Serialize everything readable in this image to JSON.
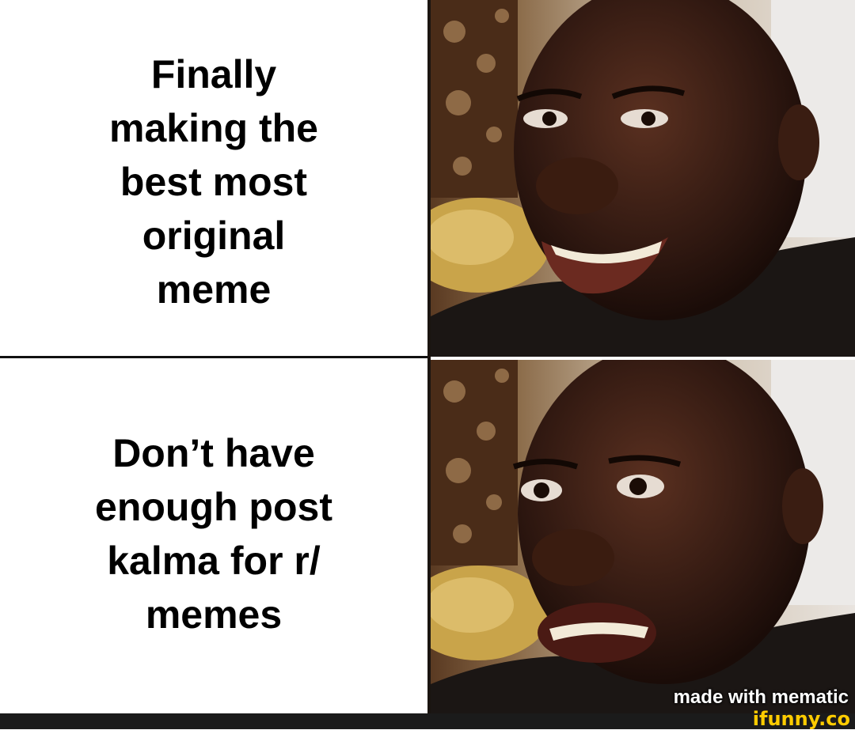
{
  "meme": {
    "top_caption": "Finally\nmaking the\nbest most\noriginal\nmeme",
    "bottom_caption": "Don’t have\nenough post\nkalma for r/\nmemes",
    "top_image": "happy-man-smiling",
    "bottom_image": "man-disappointed",
    "watermark": "made with mematic",
    "site_logo": "ifunny.co"
  },
  "colors": {
    "text": "#000000",
    "background": "#ffffff",
    "logo": "#ffcc00"
  }
}
